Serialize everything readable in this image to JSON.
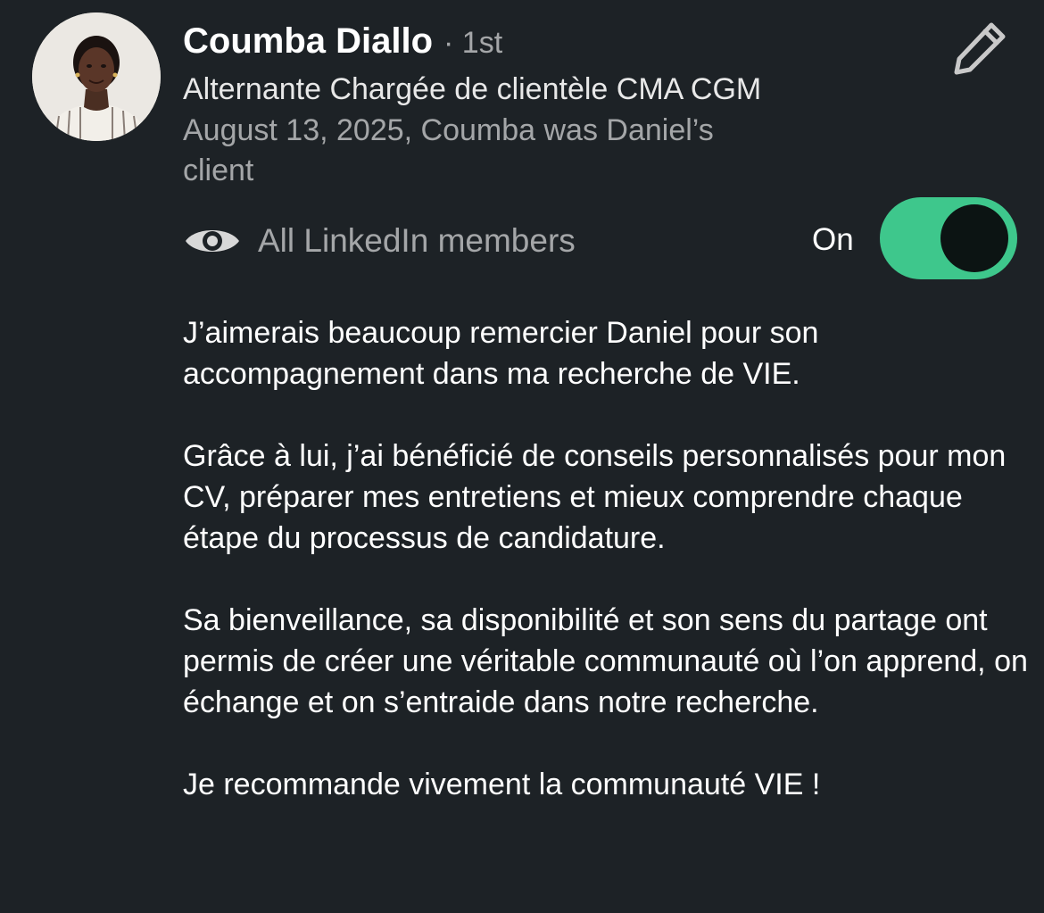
{
  "recommender": {
    "name": "Coumba Diallo",
    "degree": "· 1st",
    "headline": "Alternante Chargée de clientèle CMA CGM",
    "relationship": "August 13, 2025, Coumba was Daniel’s client",
    "avatar": "profile-photo"
  },
  "actions": {
    "edit_icon": "pencil-icon"
  },
  "visibility": {
    "icon": "eye-icon",
    "label": "All LinkedIn members",
    "toggle_label": "On",
    "toggle_state": true,
    "toggle_color": "#3ec78c"
  },
  "recommendation": {
    "paragraphs": [
      "J’aimerais beaucoup remercier Daniel pour son accompagnement dans ma recherche de VIE.",
      "Grâce à lui, j’ai bénéficié de conseils personnalisés pour mon CV, préparer mes entretiens et mieux comprendre chaque étape du processus de candidature.",
      "Sa bienveillance, sa disponibilité et son sens du partage ont permis de créer une véritable communauté où l’on apprend, on échange et on s’entraide dans notre recherche.",
      "Je recommande vivement la communauté VIE !"
    ]
  },
  "colors": {
    "background": "#1d2226",
    "primary_text": "#ffffff",
    "secondary_text": "rgba(255,255,255,0.6)"
  }
}
